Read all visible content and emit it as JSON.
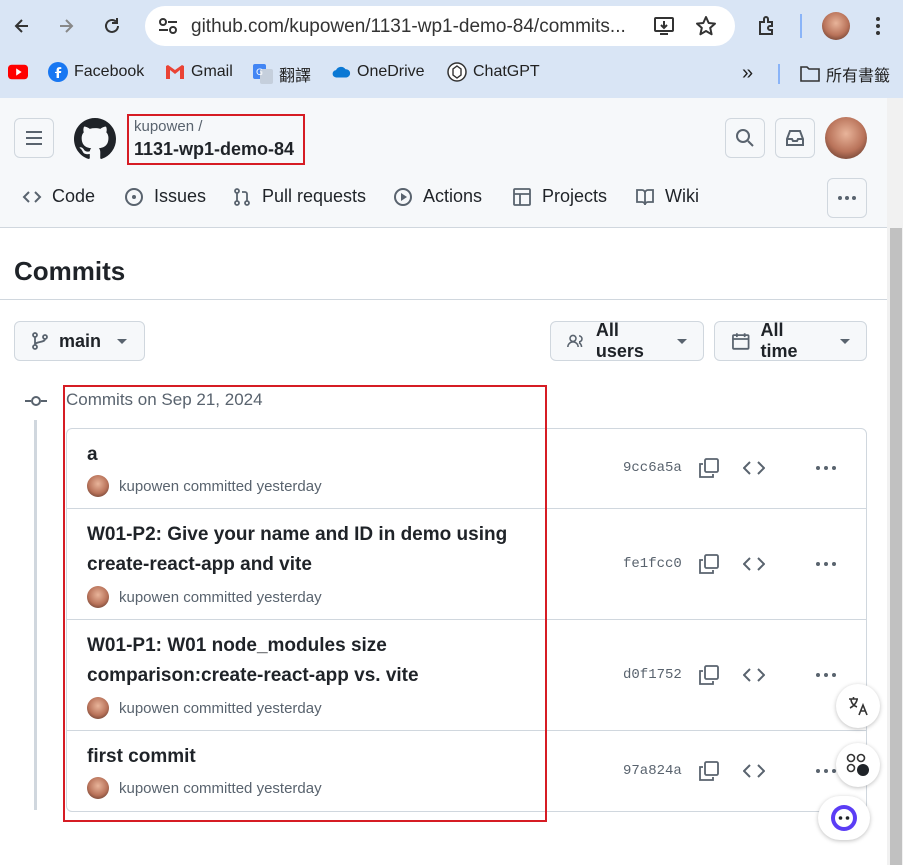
{
  "browser": {
    "url": "github.com/kupowen/1131-wp1-demo-84/commits...",
    "bookmarks": [
      {
        "label": "",
        "icon": "youtube-icon"
      },
      {
        "label": "Facebook",
        "icon": "facebook-icon"
      },
      {
        "label": "Gmail",
        "icon": "gmail-icon"
      },
      {
        "label": "翻譯",
        "icon": "translate-icon"
      },
      {
        "label": "OneDrive",
        "icon": "onedrive-icon"
      },
      {
        "label": "ChatGPT",
        "icon": "chatgpt-icon"
      }
    ],
    "more_bookmarks": "»",
    "all_bookmarks": "所有書籤"
  },
  "repo": {
    "owner": "kupowen /",
    "name": "1131-wp1-demo-84"
  },
  "tabs": [
    {
      "label": "Code",
      "icon": "code-icon"
    },
    {
      "label": "Issues",
      "icon": "issue-icon"
    },
    {
      "label": "Pull requests",
      "icon": "pull-request-icon"
    },
    {
      "label": "Actions",
      "icon": "play-icon"
    },
    {
      "label": "Projects",
      "icon": "table-icon"
    },
    {
      "label": "Wiki",
      "icon": "book-icon"
    }
  ],
  "page_title": "Commits",
  "filters": {
    "branch": "main",
    "users": "All users",
    "time": "All time"
  },
  "commits_date": "Commits on Sep 21, 2024",
  "commits": [
    {
      "message": "a",
      "author": "kupowen",
      "meta": "committed yesterday",
      "sha": "9cc6a5a"
    },
    {
      "message": "W01-P2: Give your name and ID in demo using create-react-app and vite",
      "author": "kupowen",
      "meta": "committed yesterday",
      "sha": "fe1fcc0"
    },
    {
      "message": "W01-P1: W01 node_modules size comparison:create-react-app vs. vite",
      "author": "kupowen",
      "meta": "committed yesterday",
      "sha": "d0f1752"
    },
    {
      "message": "first commit",
      "author": "kupowen",
      "meta": "committed yesterday",
      "sha": "97a824a"
    }
  ],
  "colors": {
    "annotation_red": "#d61c24",
    "chrome_bg": "#d9e5f5",
    "border": "#d0d7de"
  }
}
